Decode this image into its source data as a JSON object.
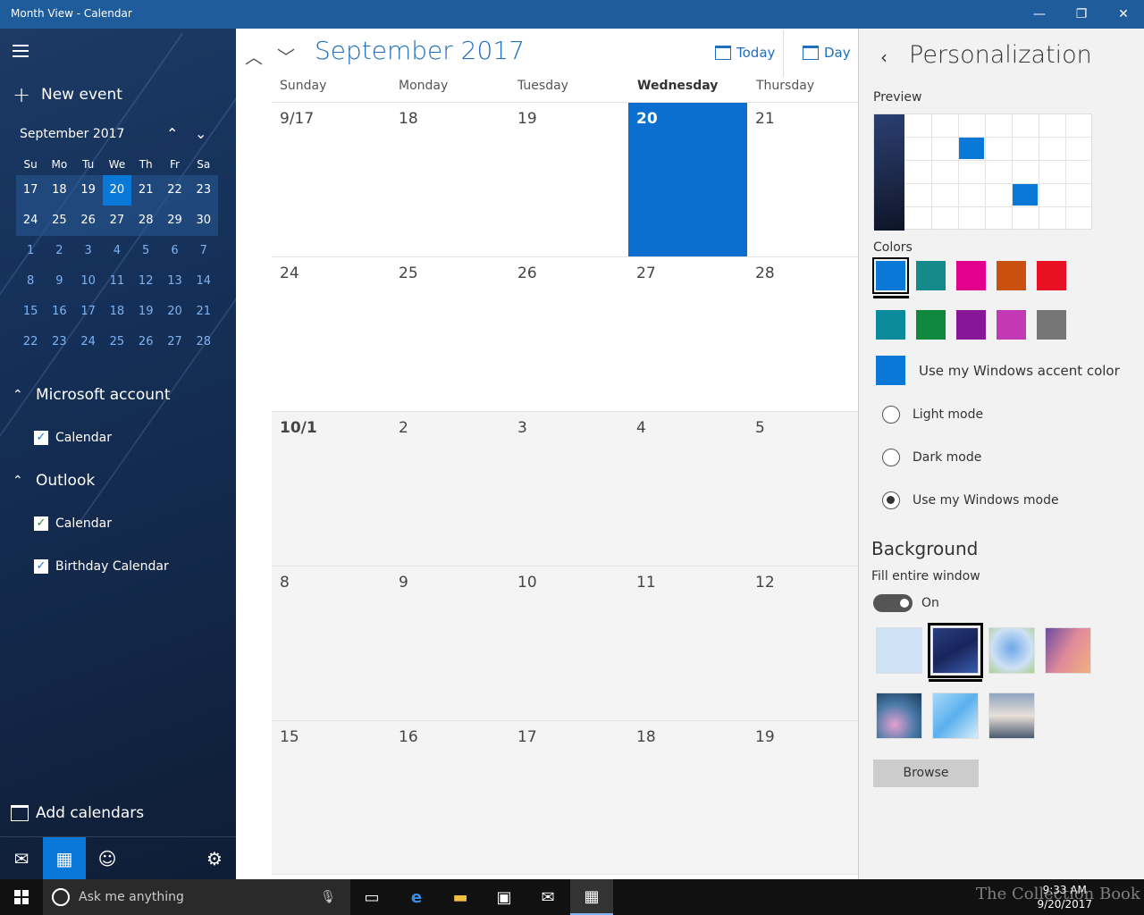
{
  "window": {
    "title": "Month View - Calendar",
    "minimize": "—",
    "restore": "❐",
    "close": "✕"
  },
  "sidebar": {
    "new_event": "New event",
    "mini": {
      "month_label": "September 2017",
      "dow": [
        "Su",
        "Mo",
        "Tu",
        "We",
        "Th",
        "Fr",
        "Sa"
      ],
      "rows": [
        [
          "17",
          "18",
          "19",
          "20",
          "21",
          "22",
          "23"
        ],
        [
          "24",
          "25",
          "26",
          "27",
          "28",
          "29",
          "30"
        ],
        [
          "1",
          "2",
          "3",
          "4",
          "5",
          "6",
          "7"
        ],
        [
          "8",
          "9",
          "10",
          "11",
          "12",
          "13",
          "14"
        ],
        [
          "15",
          "16",
          "17",
          "18",
          "19",
          "20",
          "21"
        ],
        [
          "22",
          "23",
          "24",
          "25",
          "26",
          "27",
          "28"
        ]
      ]
    },
    "accounts": [
      {
        "name": "Microsoft account",
        "calendars": [
          "Calendar"
        ]
      },
      {
        "name": "Outlook",
        "calendars": [
          "Calendar",
          "Birthday Calendar"
        ]
      }
    ],
    "add_calendars": "Add calendars"
  },
  "main": {
    "month_title": "September 2017",
    "today_label": "Today",
    "day_label": "Day",
    "dow": [
      "Sunday",
      "Monday",
      "Tuesday",
      "Wednesday",
      "Thursday"
    ],
    "weeks": [
      [
        "9/17",
        "18",
        "19",
        "20",
        "21"
      ],
      [
        "24",
        "25",
        "26",
        "27",
        "28"
      ],
      [
        "10/1",
        "2",
        "3",
        "4",
        "5"
      ],
      [
        "8",
        "9",
        "10",
        "11",
        "12"
      ],
      [
        "15",
        "16",
        "17",
        "18",
        "19"
      ]
    ]
  },
  "panel": {
    "title": "Personalization",
    "preview_label": "Preview",
    "colors_label": "Colors",
    "colors": [
      "#0a78d7",
      "#148a8a",
      "#e3008c",
      "#ca5010",
      "#e81123",
      "#0b8a9c",
      "#10893e",
      "#881798",
      "#c239b3",
      "#767676"
    ],
    "accent_label": "Use my Windows accent color",
    "modes": [
      "Light mode",
      "Dark mode",
      "Use my Windows mode"
    ],
    "background_title": "Background",
    "fill_label": "Fill entire window",
    "toggle_state": "On",
    "browse_label": "Browse"
  },
  "taskbar": {
    "search_placeholder": "Ask me anything",
    "time": "9:33 AM",
    "date": "9/20/2017",
    "watermark": "The Collection Book"
  }
}
